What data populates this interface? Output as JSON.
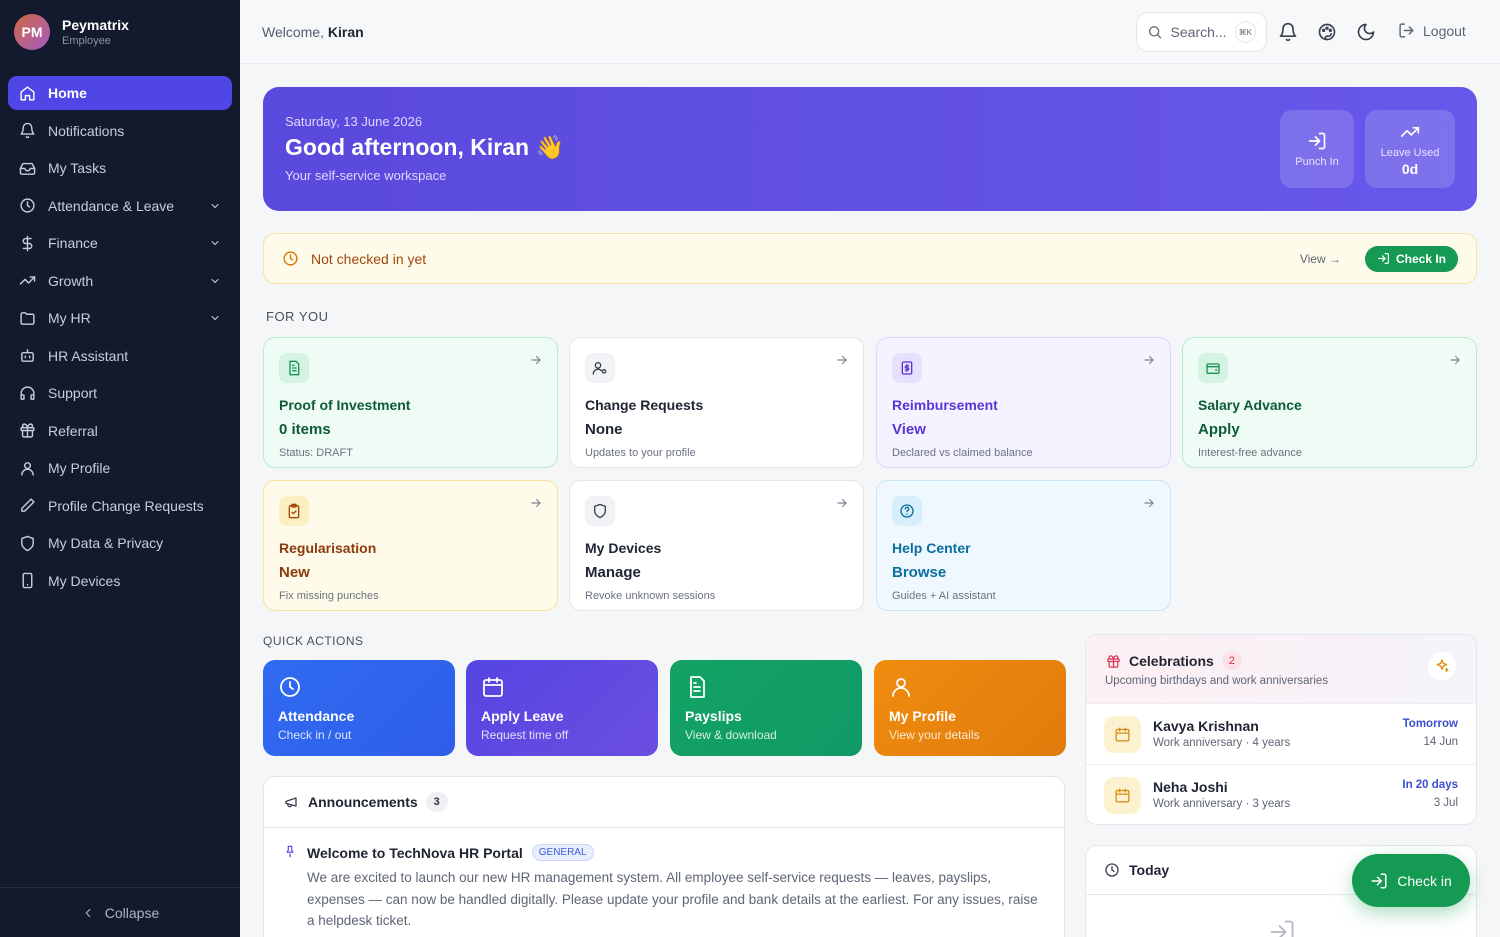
{
  "brand": {
    "initials": "PM",
    "name": "Peymatrix",
    "role": "Employee"
  },
  "sidebar": {
    "items": [
      {
        "label": "Home",
        "icon": "home-icon",
        "active": true,
        "expandable": false
      },
      {
        "label": "Notifications",
        "icon": "bell-icon",
        "expandable": false
      },
      {
        "label": "My Tasks",
        "icon": "inbox-icon",
        "expandable": false
      },
      {
        "label": "Attendance & Leave",
        "icon": "clock-icon",
        "expandable": true
      },
      {
        "label": "Finance",
        "icon": "dollar-icon",
        "expandable": true
      },
      {
        "label": "Growth",
        "icon": "trend-icon",
        "expandable": true
      },
      {
        "label": "My HR",
        "icon": "folder-icon",
        "expandable": true
      },
      {
        "label": "HR Assistant",
        "icon": "bot-icon",
        "expandable": false
      },
      {
        "label": "Support",
        "icon": "headset-icon",
        "expandable": false
      },
      {
        "label": "Referral",
        "icon": "gift-icon",
        "expandable": false
      },
      {
        "label": "My Profile",
        "icon": "user-icon",
        "expandable": false
      },
      {
        "label": "Profile Change Requests",
        "icon": "pen-icon",
        "expandable": false
      },
      {
        "label": "My Data & Privacy",
        "icon": "shield-icon",
        "expandable": false
      },
      {
        "label": "My Devices",
        "icon": "phone-icon",
        "expandable": false
      }
    ],
    "collapse_label": "Collapse"
  },
  "topbar": {
    "welcome_prefix": "Welcome,",
    "user": "Kiran",
    "search_placeholder": "Search...",
    "search_shortcut": "⌘K",
    "logout": "Logout"
  },
  "hero": {
    "date": "Saturday, 13 June 2026",
    "greeting": "Good afternoon, Kiran 👋",
    "subtitle": "Your self-service workspace",
    "punch_label": "Punch In",
    "leave_label": "Leave Used",
    "leave_value": "0d"
  },
  "alert": {
    "text": "Not checked in yet",
    "view": "View →",
    "button": "Check In"
  },
  "for_you": {
    "title": "FOR YOU",
    "cards": [
      {
        "title": "Proof of Investment",
        "value": "0 items",
        "sub": "Status: DRAFT",
        "theme": "green"
      },
      {
        "title": "Change Requests",
        "value": "None",
        "sub": "Updates to your profile",
        "theme": "white"
      },
      {
        "title": "Reimbursement",
        "value": "View",
        "sub": "Declared vs claimed balance",
        "theme": "purple"
      },
      {
        "title": "Salary Advance",
        "value": "Apply",
        "sub": "Interest-free advance",
        "theme": "green"
      },
      {
        "title": "Regularisation",
        "value": "New",
        "sub": "Fix missing punches",
        "theme": "amber"
      },
      {
        "title": "My Devices",
        "value": "Manage",
        "sub": "Revoke unknown sessions",
        "theme": "white"
      },
      {
        "title": "Help Center",
        "value": "Browse",
        "sub": "Guides + AI assistant",
        "theme": "blue"
      }
    ]
  },
  "quick_actions": {
    "title": "QUICK ACTIONS",
    "items": [
      {
        "title": "Attendance",
        "sub": "Check in / out",
        "color": "#2f6bf0"
      },
      {
        "title": "Apply Leave",
        "sub": "Request time off",
        "color": "#5545e2"
      },
      {
        "title": "Payslips",
        "sub": "View & download",
        "color": "#13a363"
      },
      {
        "title": "My Profile",
        "sub": "View your details",
        "color": "#f08c0f"
      }
    ]
  },
  "announcements": {
    "title": "Announcements",
    "count": "3",
    "item": {
      "title": "Welcome to TechNova HR Portal",
      "tag": "GENERAL",
      "body": "We are excited to launch our new HR management system. All employee self-service requests — leaves, payslips, expenses — can now be handled digitally. Please update your profile and bank details at the earliest. For any issues, raise a helpdesk ticket."
    }
  },
  "celebrations": {
    "title": "Celebrations",
    "count": "2",
    "subtitle": "Upcoming birthdays and work anniversaries",
    "items": [
      {
        "name": "Kavya Krishnan",
        "detail": "Work anniversary · 4 years",
        "when": "Tomorrow",
        "date": "14 Jun"
      },
      {
        "name": "Neha Joshi",
        "detail": "Work anniversary · 3 years",
        "when": "In 20 days",
        "date": "3 Jul"
      }
    ]
  },
  "today": {
    "title": "Today"
  },
  "fab": {
    "label": "Check in"
  },
  "colors": {
    "sidebar": "#141a2e",
    "accent": "#5046e5",
    "success": "#149a52",
    "hero": "#5a49dd"
  }
}
